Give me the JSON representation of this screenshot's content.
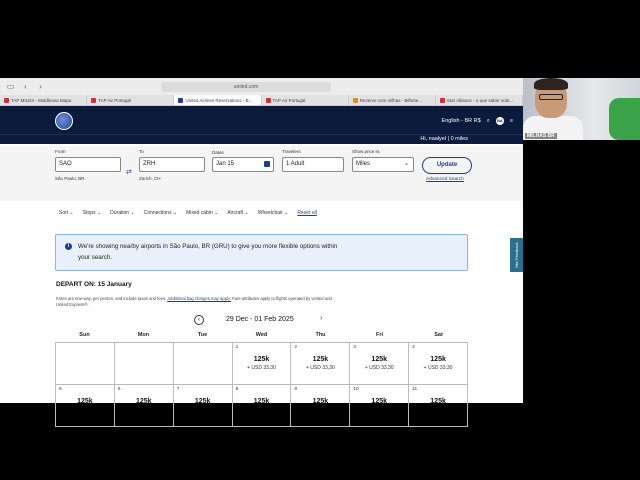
{
  "browser": {
    "url": "united.com",
    "tabs": [
      {
        "label": "TAP MILES - Middlesea Mapa",
        "color": "red"
      },
      {
        "label": "TAP Air Portugal",
        "color": "red"
      },
      {
        "label": "United Airlines Reservations - B...",
        "color": "blue",
        "active": true
      },
      {
        "label": "TAP Air Portugal",
        "color": "red"
      },
      {
        "label": "Reserve com milhas - Bilhete...",
        "color": "orange"
      },
      {
        "label": "Star Alliance - o que saber sobr...",
        "color": "red"
      }
    ]
  },
  "header": {
    "language": "English - BR R$",
    "avatar_initials": "NA",
    "greeting": "Hi, naalyel | 0 miles"
  },
  "search": {
    "from_label": "From",
    "from_value": "SAO",
    "from_sub": "São Paulo, BR",
    "to_label": "To",
    "to_value": "ZRH",
    "to_sub": "Zürich, CH",
    "dates_label": "Dates",
    "dates_value": "Jan 15",
    "travelers_label": "Travelers",
    "travelers_value": "1 Adult",
    "price_label": "Show price in:",
    "price_value": "Miles",
    "update_label": "Update",
    "advanced_label": "Advanced Search"
  },
  "filters": [
    "Sort",
    "Stops",
    "Duration",
    "Connections",
    "Mixed cabin",
    "Aircraft",
    "Wheelchair"
  ],
  "filters_reset": "Reset all",
  "info": {
    "text": "We're showing nearby airports in São Paulo, BR (GRU) to give you more flexible options within your search."
  },
  "depart": "DEPART ON: 15 January",
  "fares_note_a": "Fares are one-way, per person, and include taxes and fees.",
  "fares_note_link": "Additional bag charges may apply.",
  "fares_note_b": "Fare attributes apply to flights operated by United and United Express®.",
  "calendar": {
    "prev": "‹",
    "range": "29 Dec - 01 Feb 2025",
    "next": "›",
    "days": [
      "Sun",
      "Mon",
      "Tue",
      "Wed",
      "Thu",
      "Fri",
      "Sat"
    ],
    "cells": [
      {
        "d": "",
        "p": "",
        "t": ""
      },
      {
        "d": "",
        "p": "",
        "t": ""
      },
      {
        "d": "",
        "p": "",
        "t": ""
      },
      {
        "d": "1",
        "p": "125k",
        "t": "+ USD 33,30"
      },
      {
        "d": "2",
        "p": "125k",
        "t": "+ USD 33,30"
      },
      {
        "d": "3",
        "p": "125k",
        "t": "+ USD 33,30"
      },
      {
        "d": "4",
        "p": "125k",
        "t": "+ USD 33,30"
      },
      {
        "d": "5",
        "p": "125k",
        "t": ""
      },
      {
        "d": "6",
        "p": "125k",
        "t": ""
      },
      {
        "d": "7",
        "p": "125k",
        "t": ""
      },
      {
        "d": "8",
        "p": "125k",
        "t": ""
      },
      {
        "d": "9",
        "p": "125k",
        "t": ""
      },
      {
        "d": "10",
        "p": "125k",
        "t": ""
      },
      {
        "d": "11",
        "p": "125k",
        "t": ""
      }
    ]
  },
  "feedback": "Site Feedback",
  "webcam": {
    "label": "MILHAS BR"
  }
}
